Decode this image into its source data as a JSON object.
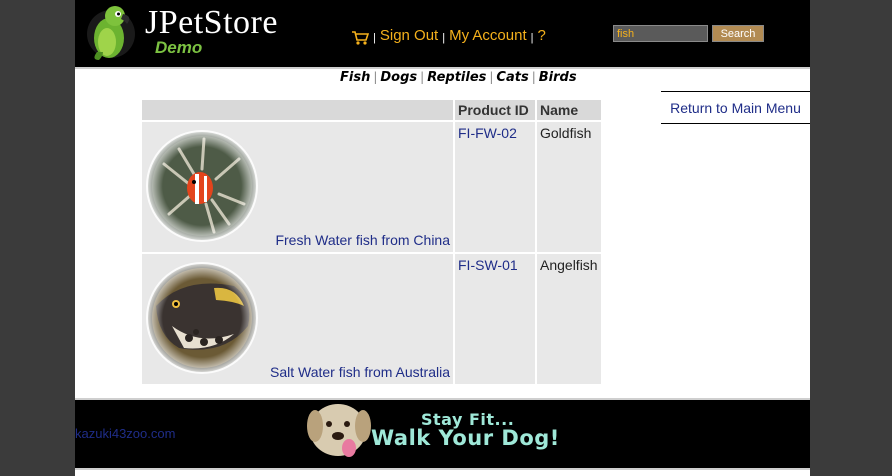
{
  "header": {
    "logo_title": "JPetStore",
    "logo_subtitle": "Demo",
    "menu": {
      "sign_out": "Sign Out",
      "my_account": "My Account",
      "help": "?",
      "separator": "|"
    },
    "search": {
      "value": "fish",
      "button": "Search"
    }
  },
  "quick_links": [
    "Fish",
    "Dogs",
    "Reptiles",
    "Cats",
    "Birds"
  ],
  "back_link": "Return to Main Menu",
  "table": {
    "headers": [
      "",
      "Product ID",
      "Name"
    ],
    "rows": [
      {
        "image_icon": "clownfish-photo",
        "description": "Fresh Water fish from China",
        "product_id": "FI-FW-02",
        "name": "Goldfish"
      },
      {
        "image_icon": "triggerfish-photo",
        "description": "Salt Water fish from Australia",
        "product_id": "FI-SW-01",
        "name": "Angelfish"
      }
    ]
  },
  "footer": {
    "user": "kazuki43zoo.com",
    "banner_line1": "Stay Fit...",
    "banner_line2": "Walk Your Dog!"
  },
  "colors": {
    "header_bg": "#000000",
    "menu_link": "#f5b11c",
    "link_blue": "#1f2d88",
    "banner_text": "#9fe8d8",
    "logo_subtitle": "#7cc242"
  }
}
